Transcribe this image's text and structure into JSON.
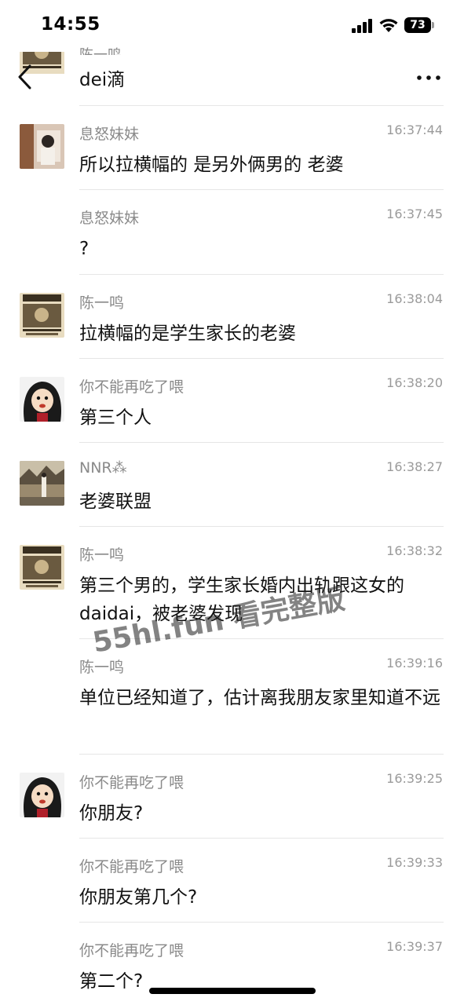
{
  "status_bar": {
    "time": "14:55",
    "battery": "73"
  },
  "header": {
    "title": "dei滴",
    "partial_sender": "陈一鸣"
  },
  "messages": [
    {
      "sender": "息怒妹妹",
      "time": "16:37:44",
      "text": "所以拉横幅的 是另外俩男的 老婆",
      "avatar": "photo-woman"
    },
    {
      "sender": "息怒妹妹",
      "time": "16:37:45",
      "text": "?",
      "avatar": ""
    },
    {
      "sender": "陈一鸣",
      "time": "16:38:04",
      "text": "拉横幅的是学生家长的老婆",
      "avatar": "wanted-poster"
    },
    {
      "sender": "你不能再吃了喂",
      "time": "16:38:20",
      "text": "第三个人",
      "avatar": "cartoon-girl"
    },
    {
      "sender": "NNR⁂",
      "time": "16:38:27",
      "text": "老婆联盟",
      "avatar": "photo-scenery"
    },
    {
      "sender": "陈一鸣",
      "time": "16:38:32",
      "text": "第三个男的，学生家长婚内出轨跟这女的daidai，被老婆发现",
      "avatar": "wanted-poster"
    },
    {
      "sender": "陈一鸣",
      "time": "16:39:16",
      "text": "单位已经知道了，估计离我朋友家里知道不远",
      "avatar": ""
    },
    {
      "sender": "你不能再吃了喂",
      "time": "16:39:25",
      "text": "你朋友?",
      "avatar": "cartoon-girl"
    },
    {
      "sender": "你不能再吃了喂",
      "time": "16:39:33",
      "text": "你朋友第几个?",
      "avatar": ""
    },
    {
      "sender": "你不能再吃了喂",
      "time": "16:39:37",
      "text": "第二个?",
      "avatar": ""
    }
  ],
  "watermark": "55hl.fun 看完整版",
  "icons": {
    "back": "chevron-left-icon",
    "more": "more-dots-icon",
    "signal": "signal-icon",
    "wifi": "wifi-icon",
    "battery": "battery-icon"
  }
}
